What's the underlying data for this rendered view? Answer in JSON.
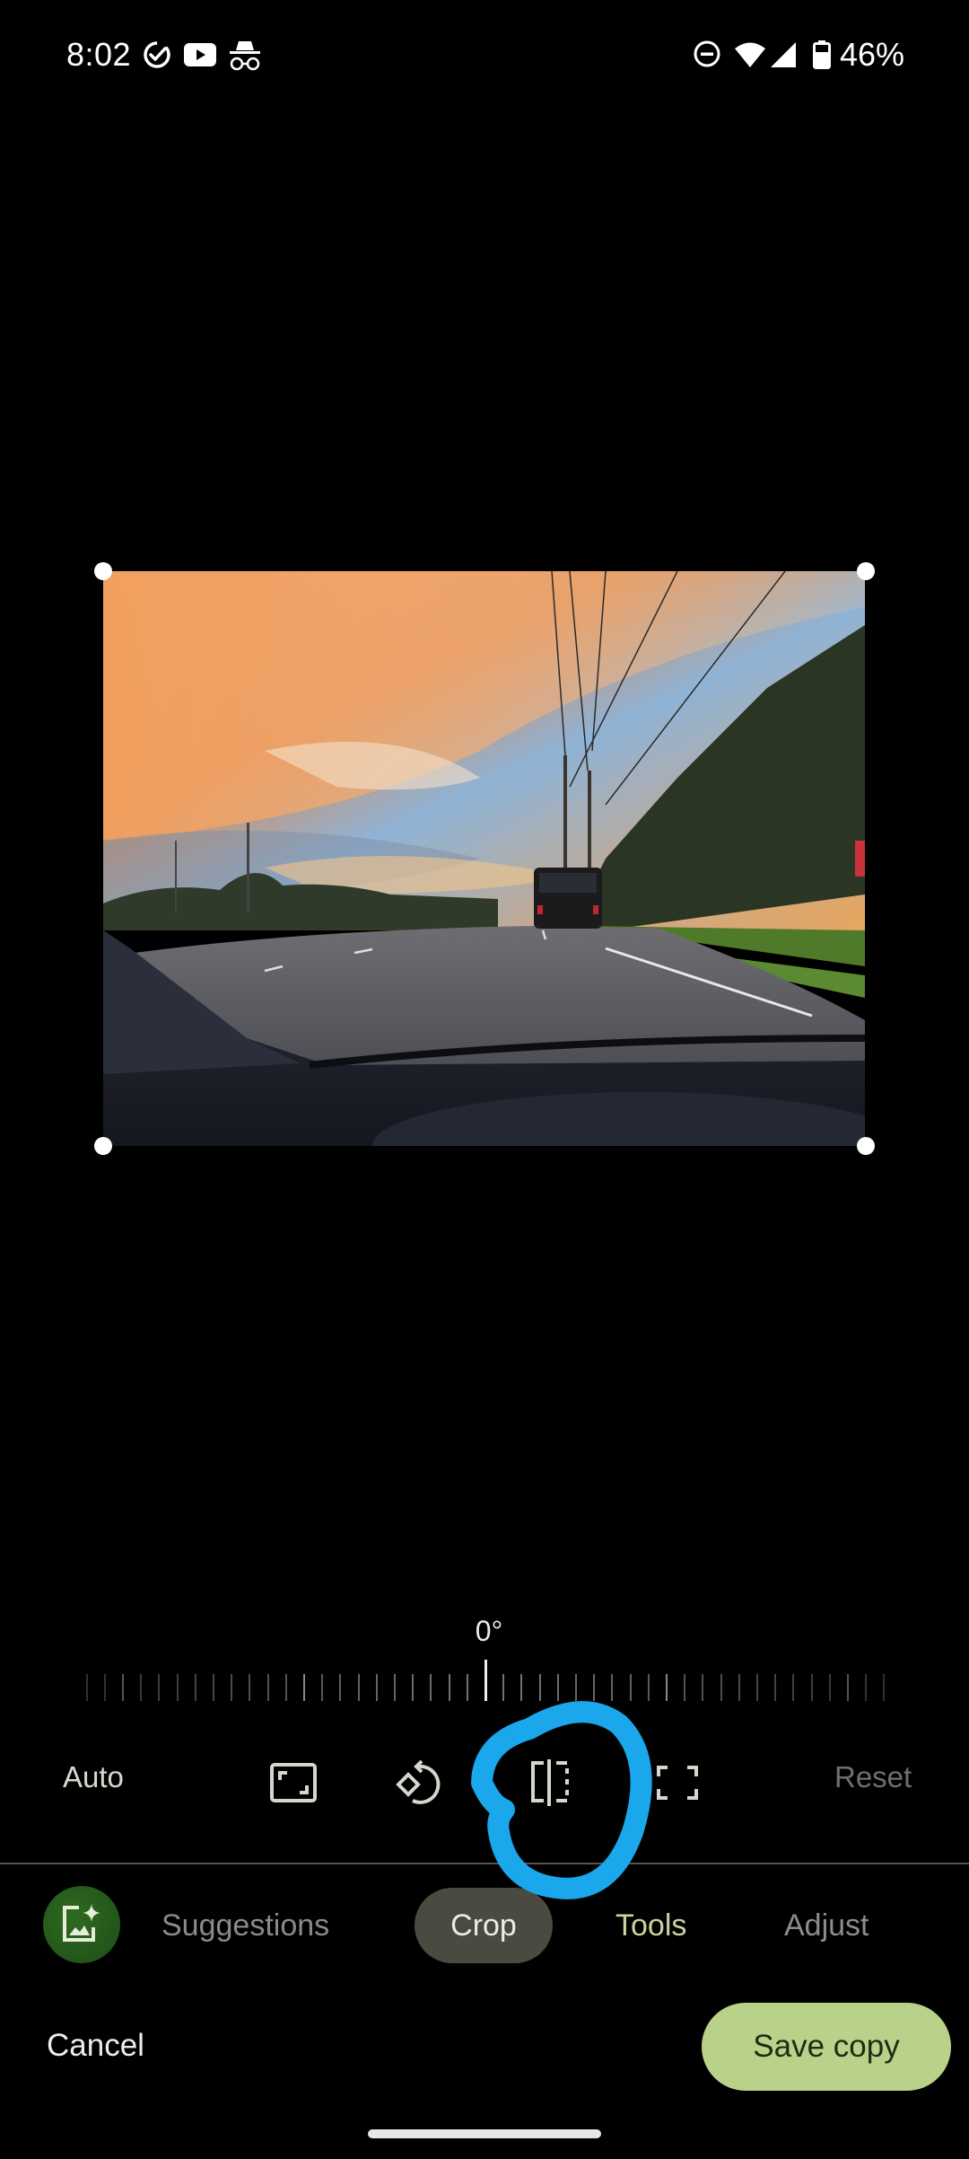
{
  "status_bar": {
    "time": "8:02",
    "left_icons": [
      "tasks-check-icon",
      "youtube-icon",
      "incognito-icon"
    ],
    "right_icons": [
      "do-not-disturb-icon",
      "wifi-icon",
      "cell-signal-icon",
      "battery-icon"
    ],
    "battery_percent": "46%"
  },
  "editor": {
    "photo_description": "Sunset sky over a multi-lane road seen through a car windshield, SUV ahead, trees and power lines on right",
    "straighten_angle": "0°",
    "crop_tools": {
      "auto_label": "Auto",
      "reset_label": "Reset",
      "icons": [
        "aspect-ratio-icon",
        "rotate-icon",
        "flip-icon",
        "free-crop-icon"
      ]
    },
    "annotation_color": "#1aa7ec"
  },
  "tabs": {
    "items": [
      {
        "label": "Suggestions",
        "state": "inactive"
      },
      {
        "label": "Crop",
        "state": "active"
      },
      {
        "label": "Tools",
        "state": "highlighted"
      },
      {
        "label": "Adjust",
        "state": "inactive"
      }
    ]
  },
  "actions": {
    "cancel_label": "Cancel",
    "save_label": "Save copy"
  },
  "colors": {
    "save_button_bg": "#b9d28a",
    "active_tab_bg": "#4a4a40",
    "tools_tab_text": "#c7d59e",
    "suggest_fab_bg": "#245a1a"
  }
}
